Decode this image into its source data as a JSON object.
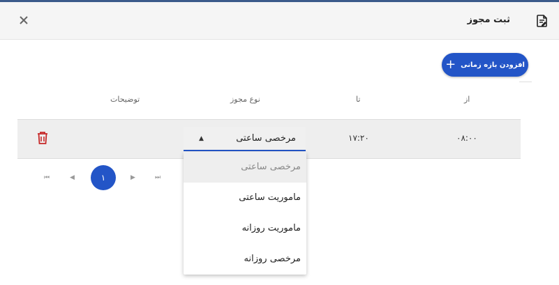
{
  "dialog": {
    "title": "ثبت مجوز",
    "add_button_label": "افزودن بازه زمانی",
    "columns": {
      "from": "از",
      "to": "تا",
      "type": "نوع مجوز",
      "description": "توضیحات"
    },
    "row": {
      "from": "۰۸:۰۰",
      "to": "۱۷:۲۰",
      "type_selected": "مرخصی ساعتی"
    },
    "type_options": [
      "مرخصی ساعتی",
      "ماموریت ساعتی",
      "ماموریت روزانه",
      "مرخصی روزانه"
    ],
    "pagination": {
      "current_page": "۱"
    },
    "colors": {
      "accent": "#2355c7",
      "delete": "#c62828"
    }
  }
}
